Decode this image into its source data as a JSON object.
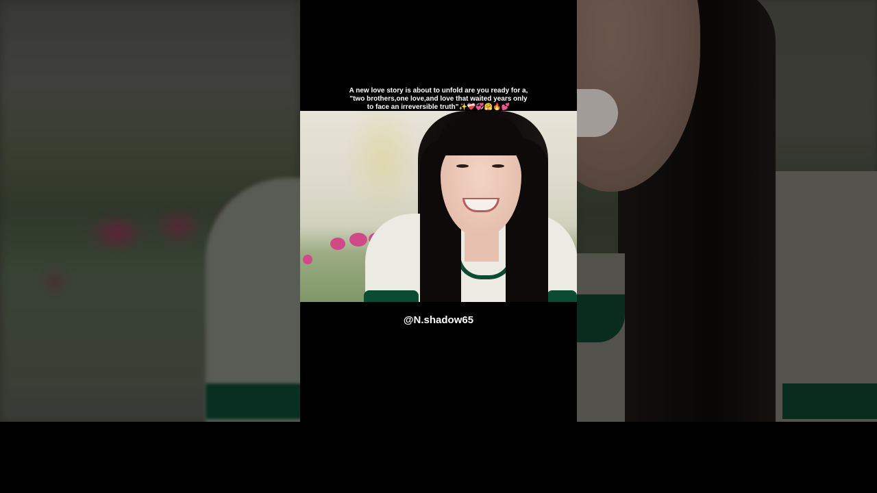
{
  "caption": {
    "line1": "A new love story is about to unfold are you ready for a,",
    "line2": "\"two brothers,one love,and love that waited years only",
    "line3": "to face an irreversible truth\"",
    "emojis": "✨❤️‍🩹💞🤗🔥💕"
  },
  "channel": {
    "handle": "@N.shadow65"
  },
  "colors": {
    "background": "#000000",
    "text": "#ffffff",
    "uniform_trim": "#0b4a33",
    "flowers": "#d04a8a"
  }
}
